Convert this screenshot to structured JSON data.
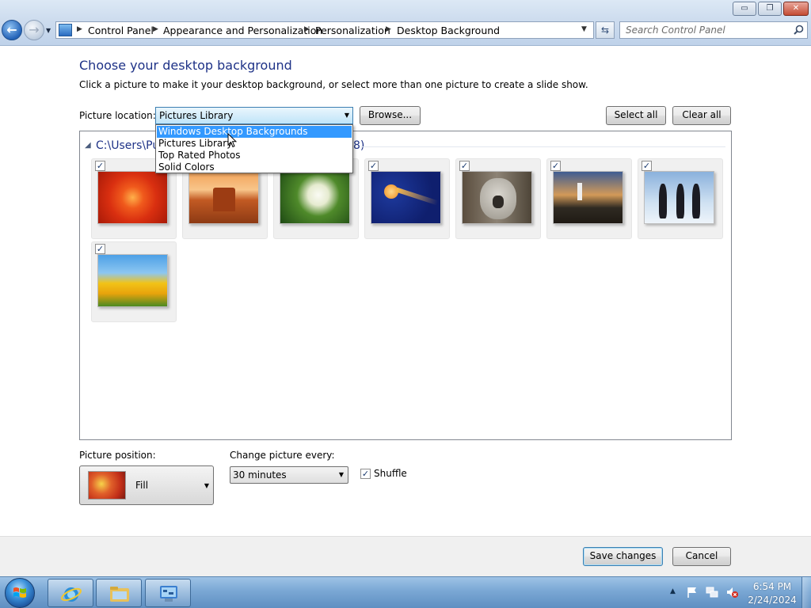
{
  "window": {
    "caption_buttons": {
      "minimize": "▭",
      "maximize": "❐",
      "close": "✕"
    }
  },
  "breadcrumb": [
    "Control Panel",
    "Appearance and Personalization",
    "Personalization",
    "Desktop Background"
  ],
  "search": {
    "placeholder": "Search Control Panel"
  },
  "content": {
    "title": "Choose your desktop background",
    "description": "Click a picture to make it your desktop background, or select more than one picture to create a slide show."
  },
  "picture_location": {
    "label": "Picture location:",
    "value": "Pictures Library",
    "options": [
      "Windows Desktop Backgrounds",
      "Pictures Library",
      "Top Rated Photos",
      "Solid Colors"
    ],
    "highlighted_option": "Windows Desktop Backgrounds"
  },
  "buttons": {
    "browse": "Browse...",
    "select_all": "Select all",
    "clear_all": "Clear all",
    "save": "Save changes",
    "cancel": "Cancel"
  },
  "group": {
    "label": "C:\\Users\\Pu",
    "count_suffix": "8)"
  },
  "pictures": [
    {
      "name": "orange-flower",
      "checked": true
    },
    {
      "name": "desert-mesa",
      "checked": true
    },
    {
      "name": "hydrangea",
      "checked": true
    },
    {
      "name": "jellyfish",
      "checked": true
    },
    {
      "name": "koala",
      "checked": true
    },
    {
      "name": "lighthouse",
      "checked": true
    },
    {
      "name": "penguins",
      "checked": true
    },
    {
      "name": "tulips",
      "checked": true
    }
  ],
  "picture_position": {
    "label": "Picture position:",
    "value": "Fill"
  },
  "change_interval": {
    "label": "Change picture every:",
    "value": "30 minutes"
  },
  "shuffle": {
    "label": "Shuffle",
    "checked": true
  },
  "taskbar": {
    "items": [
      "internet-explorer",
      "windows-explorer",
      "control-panel"
    ],
    "clock": {
      "time": "6:54 PM",
      "date": "2/24/2024"
    }
  },
  "colors": {
    "accent": "#1e3287",
    "selection": "#3399ff",
    "taskbar": "#7aa7d4"
  }
}
